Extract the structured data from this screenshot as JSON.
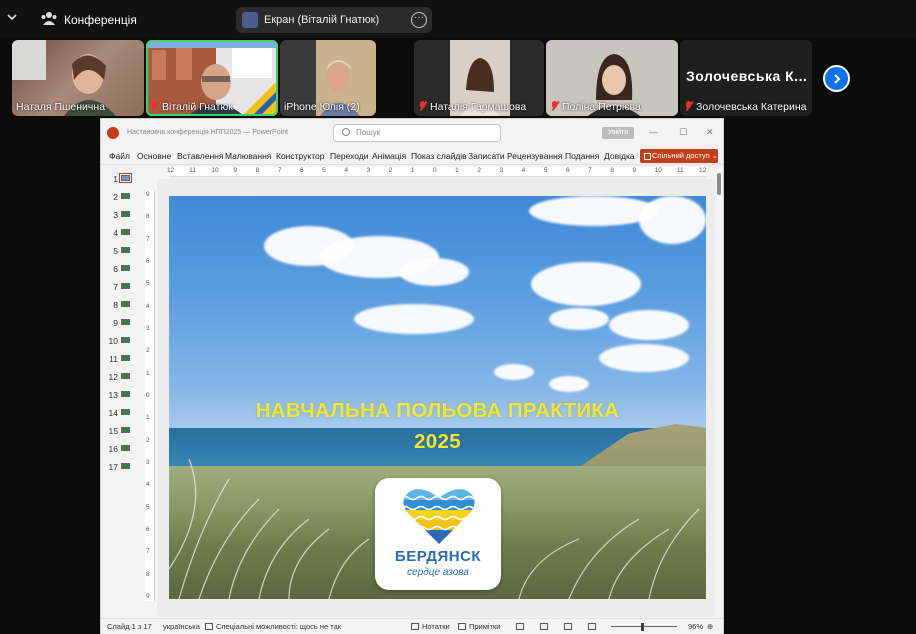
{
  "zoom": {
    "meeting_label": "Конференція",
    "share": {
      "label": "Екран (Віталій Гнатюк)"
    },
    "participants": [
      {
        "name": "Наталя Пшенична",
        "muted": false
      },
      {
        "name": "Віталій Гнатюк",
        "muted": true,
        "active": true
      },
      {
        "name": "iPhone Юлія (2)",
        "muted": false
      },
      {
        "name": "Наталія Гармашова",
        "muted": true
      },
      {
        "name": "Поліна Петрієва",
        "muted": true
      },
      {
        "name": "Золочевська Катерина",
        "muted": true,
        "display_name": "Золочевська К..."
      }
    ],
    "speaker_color": "#3ad26f",
    "accent_blue": "#0e71eb"
  },
  "ppt": {
    "doc_title": "Настановча конференція НПП2025 — PowerPoint",
    "search_placeholder": "Пошук",
    "signin_label": "Увійти",
    "window_controls": [
      "—",
      "☐",
      "✕"
    ],
    "menu": [
      "Файл",
      "Основне",
      "Вставлення",
      "Малювання",
      "Конструктор",
      "Переходи",
      "Анімація",
      "Показ слайдів",
      "Записати",
      "Рецензування",
      "Подання",
      "Довідка"
    ],
    "share_button": "Спільний доступ",
    "brand_color": "#c43e1c",
    "ruler_h": [
      "12",
      "11",
      "10",
      "9",
      "8",
      "7",
      "6",
      "5",
      "4",
      "3",
      "2",
      "1",
      "0",
      "1",
      "2",
      "3",
      "4",
      "5",
      "6",
      "7",
      "8",
      "9",
      "10",
      "11",
      "12"
    ],
    "ruler_v": [
      "9",
      "8",
      "7",
      "6",
      "5",
      "4",
      "3",
      "2",
      "1",
      "0",
      "1",
      "2",
      "3",
      "4",
      "5",
      "6",
      "7",
      "8",
      "9"
    ],
    "slide_count": 17,
    "selected_slide": 1,
    "slide": {
      "title_line1": "НАВЧАЛЬНА ПОЛЬОВА ПРАКТИКА",
      "title_line2": "2025",
      "logo_text": "БЕРДЯНСК",
      "logo_subtext": "сердце азова"
    },
    "status": {
      "slide_info": "Слайд 1 з 17",
      "language": "українська",
      "accessibility": "Спеціальні можливості: щось не так",
      "notes": "Нотатки",
      "comments": "Примітки",
      "zoom": "96%"
    }
  }
}
